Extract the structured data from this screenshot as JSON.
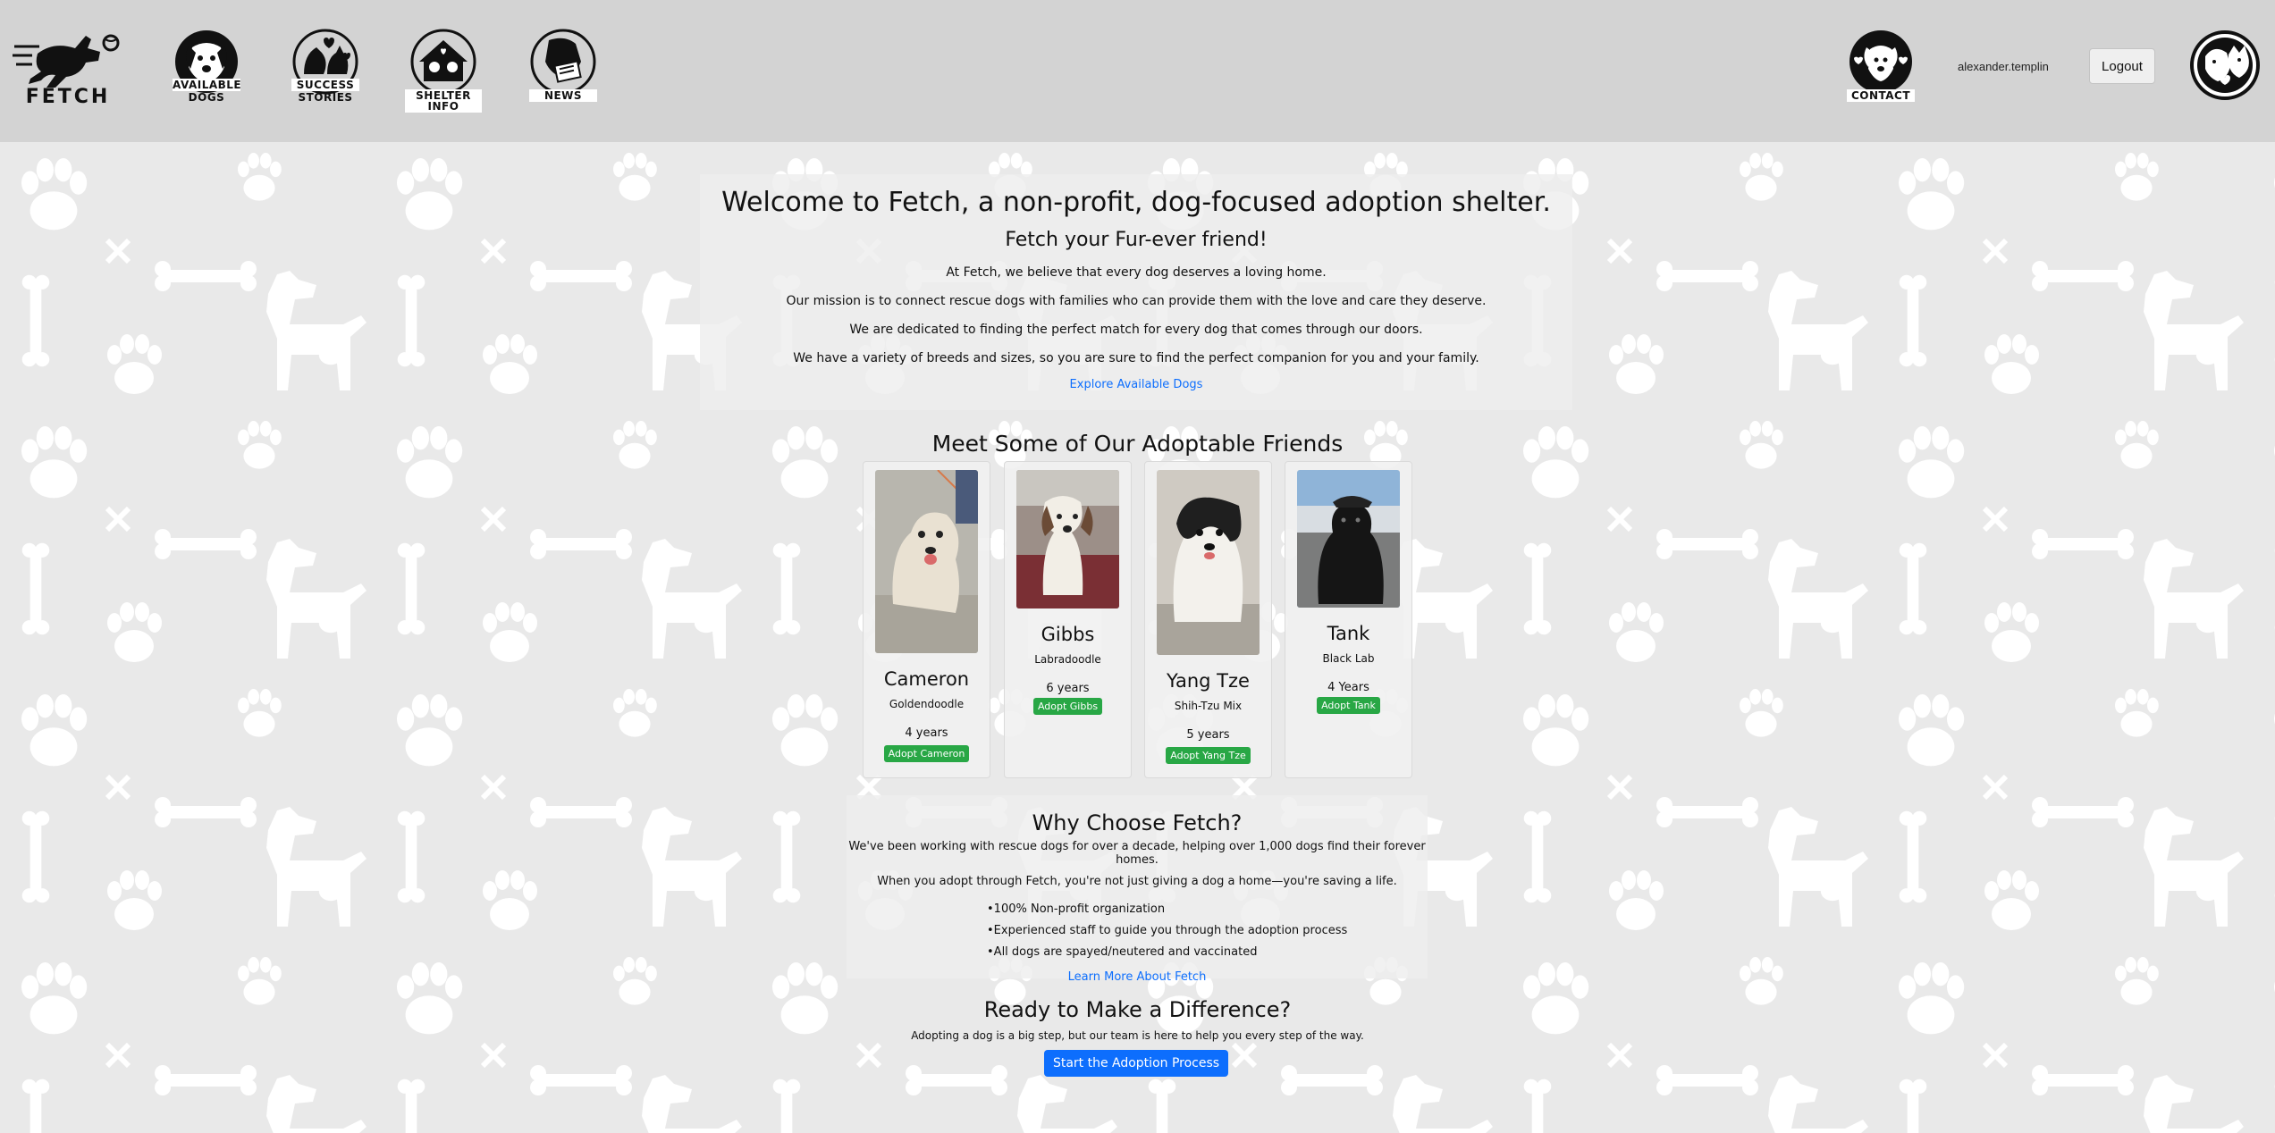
{
  "header": {
    "brand_label": "FETCH",
    "nav": [
      {
        "label": "AVAILABLE DOGS",
        "line1": "AVAILABLE",
        "line2": "DOGS"
      },
      {
        "label": "SUCCESS STORIES",
        "line1": "SUCCESS",
        "line2": "STORIES"
      },
      {
        "label": "SHELTER INFO",
        "line1": "SHELTER INFO"
      },
      {
        "label": "NEWS",
        "line1": "NEWS"
      }
    ],
    "contact_label": "CONTACT",
    "username": "alexander.templin",
    "logout_label": "Logout"
  },
  "welcome": {
    "title": "Welcome to Fetch, a non-profit, dog-focused adoption shelter.",
    "subtitle": "Fetch your Fur-ever friend!",
    "paragraphs": [
      "At Fetch, we believe that every dog deserves a loving home.",
      "Our mission is to connect rescue dogs with families who can provide them with the love and care they deserve.",
      "We are dedicated to finding the perfect match for every dog that comes through our doors.",
      "We have a variety of breeds and sizes, so you are sure to find the perfect companion for you and your family."
    ],
    "explore_link": "Explore Available Dogs"
  },
  "adoptable": {
    "title": "Meet Some of Our Adoptable Friends",
    "dogs": [
      {
        "name": "Cameron",
        "breed": "Goldendoodle",
        "age": "4 years",
        "button": "Adopt Cameron"
      },
      {
        "name": "Gibbs",
        "breed": "Labradoodle",
        "age": "6 years",
        "button": "Adopt Gibbs"
      },
      {
        "name": "Yang Tze",
        "breed": "Shih-Tzu Mix",
        "age": "5 years",
        "button": "Adopt Yang Tze"
      },
      {
        "name": "Tank",
        "breed": "Black Lab",
        "age": "4 Years",
        "button": "Adopt Tank"
      }
    ]
  },
  "why": {
    "title": "Why Choose Fetch?",
    "line1": "We've been working with rescue dogs for over a decade, helping over 1,000 dogs find their forever homes.",
    "line2": "When you adopt through Fetch, you're not just giving a dog a home—you're saving a life.",
    "bullets": [
      "100% Non-profit organization",
      "Experienced staff to guide you through the adoption process",
      "All dogs are spayed/neutered and vaccinated"
    ],
    "learn_link": "Learn More About Fetch"
  },
  "ready": {
    "title": "Ready to Make a Difference?",
    "text": "Adopting a dog is a big step, but our team is here to help you every step of the way.",
    "button": "Start the Adoption Process"
  },
  "colors": {
    "header_bg": "#d3d3d3",
    "adopt_green": "#28a745",
    "primary_blue": "#0d6efd",
    "link_blue": "#0d6efd"
  },
  "icons": {
    "brand": "running-dog-icon",
    "available": "dog-head-icon",
    "success": "dog-cat-hearts-icon",
    "shelter": "house-dogs-icon",
    "news": "dog-newspaper-icon",
    "contact": "dog-hearts-icon",
    "profile": "dog-cat-avatar-icon"
  }
}
